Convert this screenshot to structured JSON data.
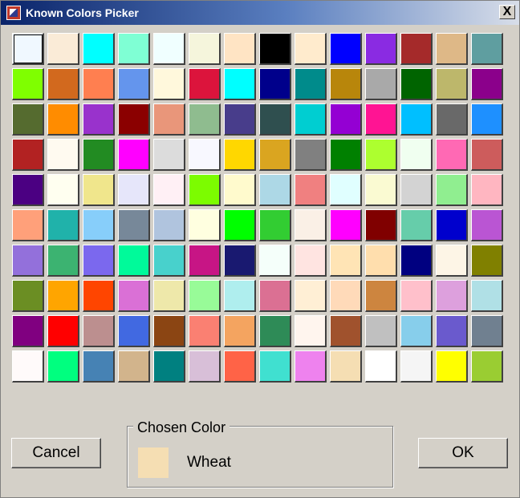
{
  "window": {
    "title": "Known Colors Picker",
    "close_label": "X",
    "icon": "app-icon"
  },
  "swatch_rows": [
    [
      "#F0F8FF",
      "#FAEBD7",
      "#00FFFF",
      "#7FFFD4",
      "#F0FFFF",
      "#F5F5DC",
      "#FFE4C4",
      "#000000",
      "#FFEBCD",
      "#0000FF",
      "#8A2BE2",
      "#A52A2A",
      "#DEB887",
      "#5F9EA0"
    ],
    [
      "#7FFF00",
      "#D2691E",
      "#FF7F50",
      "#6495ED",
      "#FFF8DC",
      "#DC143C",
      "#00FFFF",
      "#00008B",
      "#008B8B",
      "#B8860B",
      "#A9A9A9",
      "#006400",
      "#BDB76B",
      "#8B008B"
    ],
    [
      "#556B2F",
      "#FF8C00",
      "#9932CC",
      "#8B0000",
      "#E9967A",
      "#8FBC8F",
      "#483D8B",
      "#2F4F4F",
      "#00CED1",
      "#9400D3",
      "#FF1493",
      "#00BFFF",
      "#696969",
      "#1E90FF"
    ],
    [
      "#B22222",
      "#FFFAF0",
      "#228B22",
      "#FF00FF",
      "#DCDCDC",
      "#F8F8FF",
      "#FFD700",
      "#DAA520",
      "#808080",
      "#008000",
      "#ADFF2F",
      "#F0FFF0",
      "#FF69B4",
      "#CD5C5C"
    ],
    [
      "#4B0082",
      "#FFFFF0",
      "#F0E68C",
      "#E6E6FA",
      "#FFF0F5",
      "#7CFC00",
      "#FFFACD",
      "#ADD8E6",
      "#F08080",
      "#E0FFFF",
      "#FAFAD2",
      "#D3D3D3",
      "#90EE90",
      "#FFB6C1"
    ],
    [
      "#FFA07A",
      "#20B2AA",
      "#87CEFA",
      "#778899",
      "#B0C4DE",
      "#FFFFE0",
      "#00FF00",
      "#32CD32",
      "#FAF0E6",
      "#FF00FF",
      "#800000",
      "#66CDAA",
      "#0000CD",
      "#BA55D3"
    ],
    [
      "#9370DB",
      "#3CB371",
      "#7B68EE",
      "#00FA9A",
      "#48D1CC",
      "#C71585",
      "#191970",
      "#F5FFFA",
      "#FFE4E1",
      "#FFE4B5",
      "#FFDEAD",
      "#000080",
      "#FDF5E6",
      "#808000"
    ],
    [
      "#6B8E23",
      "#FFA500",
      "#FF4500",
      "#DA70D6",
      "#EEE8AA",
      "#98FB98",
      "#AFEEEE",
      "#DB7093",
      "#FFEFD5",
      "#FFDAB9",
      "#CD853F",
      "#FFC0CB",
      "#DDA0DD",
      "#B0E0E6"
    ],
    [
      "#800080",
      "#FF0000",
      "#BC8F8F",
      "#4169E1",
      "#8B4513",
      "#FA8072",
      "#F4A460",
      "#2E8B57",
      "#FFF5EE",
      "#A0522D",
      "#C0C0C0",
      "#87CEEB",
      "#6A5ACD",
      "#708090"
    ],
    [
      "#FFFAFA",
      "#00FF7F",
      "#4682B4",
      "#D2B48C",
      "#008080",
      "#D8BFD8",
      "#FF6347",
      "#40E0D0",
      "#EE82EE",
      "#F5DEB3",
      "#FFFFFF",
      "#F5F5F5",
      "#FFFF00",
      "#9ACD32"
    ]
  ],
  "selected_swatch": {
    "row": 0,
    "col": 0
  },
  "buttons": {
    "cancel": "Cancel",
    "ok": "OK"
  },
  "chosen": {
    "legend": "Chosen Color",
    "name": "Wheat",
    "color": "#F5DEB3"
  }
}
